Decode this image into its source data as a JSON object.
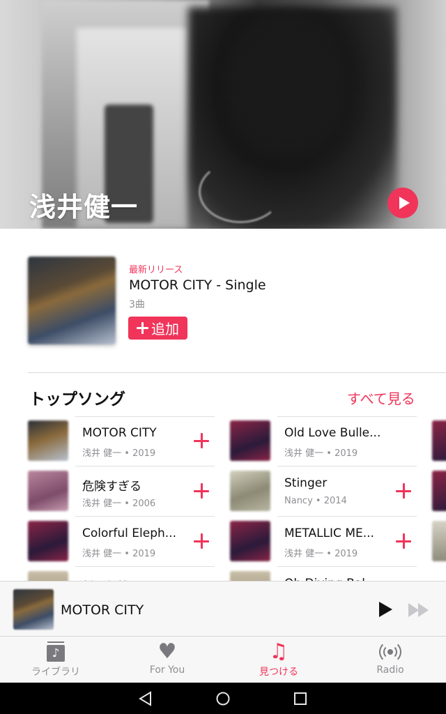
{
  "hero": {
    "artist_name": "浅井健一"
  },
  "latest_release": {
    "kicker": "最新リリース",
    "title": "MOTOR CITY - Single",
    "track_count": "3曲",
    "add_label": "追加"
  },
  "top_songs": {
    "heading": "トップソング",
    "see_all": "すべて見る",
    "items": [
      {
        "title": "MOTOR CITY",
        "subtitle": "浅井 健一 • 2019",
        "art_colors": [
          "#2a2f38",
          "#8a6a3c"
        ]
      },
      {
        "title": "Old Love Bulle...",
        "subtitle": "浅井 健一 • 2019",
        "art_colors": [
          "#8a2446",
          "#2b1a3a"
        ]
      },
      {
        "title": "危険すぎる",
        "subtitle": "浅井 健一 • 2006",
        "art_colors": [
          "#b8869c",
          "#7d4c6a"
        ]
      },
      {
        "title": "Stinger",
        "subtitle": "Nancy • 2014",
        "art_colors": [
          "#b8b5a0",
          "#6f6c5c"
        ]
      },
      {
        "title": "Colorful Eleph...",
        "subtitle": "浅井 健一 • 2019",
        "art_colors": [
          "#8a2446",
          "#2b1a3a"
        ]
      },
      {
        "title": "METALLIC ME...",
        "subtitle": "浅井 健一 • 2019",
        "art_colors": [
          "#8a2446",
          "#2b1a3a"
        ]
      },
      {
        "title": "紙飛行機",
        "subtitle": "",
        "art_colors": [
          "#c9bfa8",
          "#8a7f6a"
        ]
      },
      {
        "title": "Oh Diving Bal...",
        "subtitle": "",
        "art_colors": [
          "#c9bfa8",
          "#8a7f6a"
        ]
      }
    ]
  },
  "now_playing": {
    "title": "MOTOR CITY"
  },
  "tabs": [
    {
      "label": "ライブラリ",
      "icon": "library-icon",
      "active": false
    },
    {
      "label": "For You",
      "icon": "heart-icon",
      "active": false
    },
    {
      "label": "見つける",
      "icon": "music-note-icon",
      "active": true
    },
    {
      "label": "Radio",
      "icon": "radio-icon",
      "active": false
    }
  ],
  "colors": {
    "accent": "#f0345a",
    "inactive_tab": "#8e8e93",
    "secondary_text": "#8e8e93"
  }
}
